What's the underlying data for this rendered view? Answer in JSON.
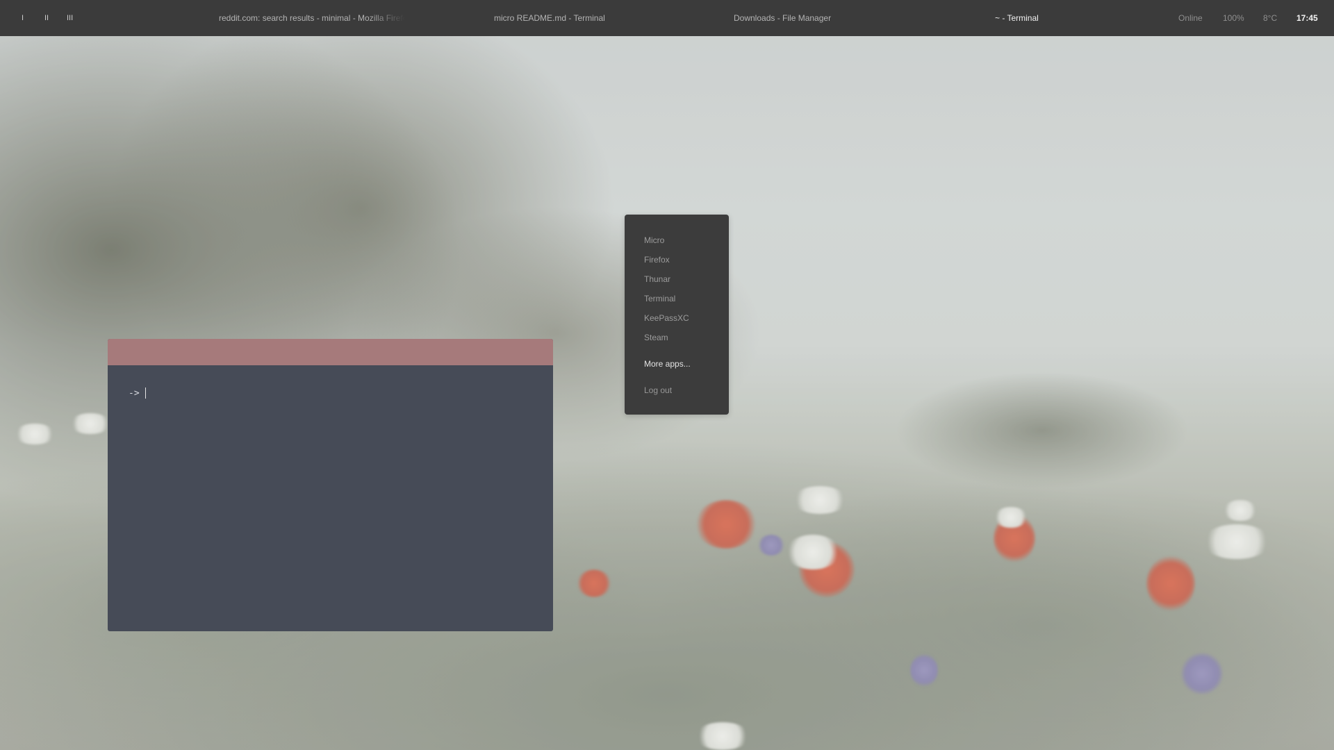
{
  "panel": {
    "workspaces": [
      "I",
      "II",
      "III"
    ],
    "tasks": [
      {
        "label": "reddit.com: search results - minimal - Mozilla Firefox",
        "active": false
      },
      {
        "label": "micro README.md - Terminal",
        "active": false
      },
      {
        "label": "Downloads - File Manager",
        "active": false
      },
      {
        "label": "~ - Terminal",
        "active": true
      }
    ],
    "status": {
      "network": "Online",
      "battery": "100%",
      "weather": "8°C",
      "clock": "17:45"
    }
  },
  "launcher": {
    "apps": [
      "Micro",
      "Firefox",
      "Thunar",
      "Terminal",
      "KeePassXC",
      "Steam"
    ],
    "more_label": "More apps...",
    "logout_label": "Log out"
  },
  "terminal": {
    "prompt": "->"
  },
  "colors": {
    "panel_bg": "#3b3b3b",
    "terminal_bg": "#464b57",
    "terminal_titlebar": "#a67a7b",
    "launcher_bg": "#3c3c3c"
  }
}
